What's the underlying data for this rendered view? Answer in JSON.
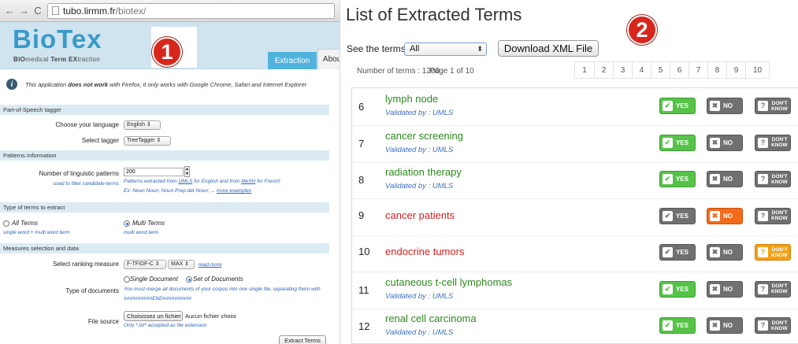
{
  "browser": {
    "url_host": "tubo.lirmm.fr",
    "url_path": "/biotex/"
  },
  "left": {
    "logo": "BioTex",
    "logo_subtitle": {
      "a": "BIO",
      "b": "medical ",
      "c": "Term ",
      "d": "EX",
      "e": "traction"
    },
    "tabs": {
      "extraction": "Extraction",
      "about": "About"
    },
    "info": {
      "pre": "This application ",
      "bold": "does not work",
      "post": " with Firefox, it only works with Google Chrome, Safari and Internet Explorer"
    },
    "sections": {
      "pos": "Part-of-Speech tagger",
      "patterns": "Patterns Information",
      "types": "Type of terms to extract",
      "measures": "Measures selection and data"
    },
    "language": {
      "label": "Choose your language",
      "value": "English"
    },
    "tagger": {
      "label": "Select tagger",
      "value": "TreeTagger"
    },
    "patterns_count": {
      "label": "Number of linguistic patterns",
      "sublabel": "used to filter candidate terms",
      "value": "200",
      "hint1_pre": "Patterns extracted from ",
      "hint1_umls": "UMLS",
      "hint1_mid": " for English and from ",
      "hint1_mesh": "MeSH",
      "hint1_post": " for French",
      "hint2_pre": "Ex: Noun Noun; Noun Prep:det Noun; ... ",
      "hint2_link": "more examples"
    },
    "term_types": {
      "all": "All Terms",
      "all_sub": "single word + multi word term",
      "multi": "Multi Terms",
      "multi_sub": "multi word term"
    },
    "ranking": {
      "label": "Select ranking measure",
      "measure": "F-TFIDF-C",
      "agg": "MAX",
      "read_more": "read more"
    },
    "doc_type": {
      "label": "Type of documents",
      "single": "Single Document",
      "set": "Set of Documents",
      "hint1": "You must merge all documents of your corpus into one single file, separating them with",
      "hint2": "##########END##########"
    },
    "file_source": {
      "label": "File source",
      "button": "Choisissez un fichier",
      "status": "Aucun fichier choisi",
      "hint": "Only *.txt* accepted as file extension"
    },
    "extract_button": "Extract Terms",
    "badge": "1"
  },
  "right": {
    "title": "List of Extracted Terms",
    "see_terms_label": "See the terms",
    "see_terms_value": "All",
    "download_button": "Download XML File",
    "number_of_terms": "Number of terms : 1200",
    "page_of": "Page 1 of 10",
    "pages": [
      "1",
      "2",
      "3",
      "4",
      "5",
      "6",
      "7",
      "8",
      "9",
      "10"
    ],
    "badge": "2",
    "vote_labels": {
      "yes": "YES",
      "no": "NO",
      "dont1": "DON'T",
      "dont2": "KNOW"
    },
    "terms": [
      {
        "num": "6",
        "term": "lymph node",
        "validated": "Validated by : UMLS",
        "color": "#2d8a1f"
      },
      {
        "num": "7",
        "term": "cancer screening",
        "validated": "Validated by : UMLS",
        "color": "#2d8a1f"
      },
      {
        "num": "8",
        "term": "radiation therapy",
        "validated": "Validated by : UMLS",
        "color": "#2d8a1f"
      },
      {
        "num": "9",
        "term": "cancer patients",
        "validated": "",
        "color": "#d62020"
      },
      {
        "num": "10",
        "term": "endocrine tumors",
        "validated": "",
        "color": "#d62020"
      },
      {
        "num": "11",
        "term": "cutaneous t-cell lymphomas",
        "validated": "Validated by : UMLS",
        "color": "#2d8a1f"
      },
      {
        "num": "12",
        "term": "renal cell carcinoma",
        "validated": "Validated by : UMLS",
        "color": "#2d8a1f"
      }
    ]
  },
  "colors": {
    "accent": "#52b2de",
    "yes": "#56c348",
    "no_active": "#f26a1b",
    "dontknow_active": "#f5a013",
    "inactive": "#707070",
    "badge": "#d8261c"
  }
}
